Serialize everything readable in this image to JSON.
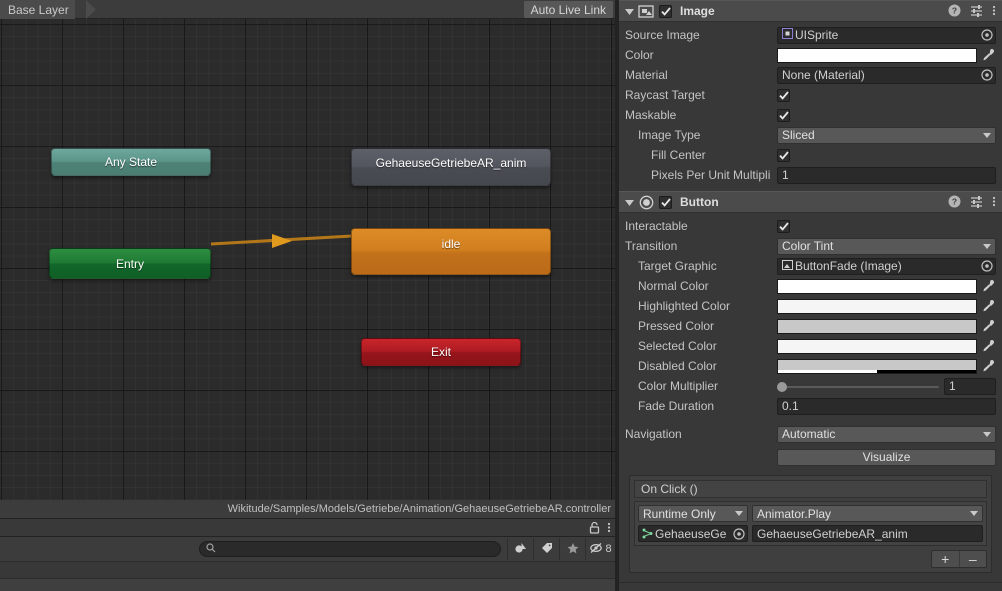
{
  "animator": {
    "breadcrumb": "Base Layer",
    "auto_live_link": "Auto Live Link",
    "asset_path": "Wikitude/Samples/Models/Getriebe/Animation/GehaeuseGetriebeAR.controller",
    "nodes": [
      {
        "name": "Any State",
        "type": "any-state",
        "color": "#5b9488"
      },
      {
        "name": "Entry",
        "type": "entry",
        "color": "#1e7a33"
      },
      {
        "name": "idle",
        "type": "state-default",
        "color": "#d2801f"
      },
      {
        "name": "Exit",
        "type": "exit",
        "color": "#ad1b22"
      },
      {
        "name": "GehaeuseGetriebeAR_anim",
        "type": "state",
        "color": "#53565e"
      }
    ],
    "transition": {
      "from": "Entry",
      "to": "idle",
      "color": "#b3771a"
    }
  },
  "project_browser": {
    "search_placeholder": "",
    "search_value": "",
    "hidden_count": "8",
    "icons": {
      "lock": "lock-icon",
      "menu": "kebab-menu-icon",
      "search": "search-icon",
      "filter_type": "filter-by-type-icon",
      "filter_label": "filter-by-label-icon",
      "favorites": "favorites-star-icon",
      "hidden_packages": "hidden-packages-icon"
    }
  },
  "inspector": {
    "components": [
      {
        "title": "Image",
        "icon": "image-component-icon",
        "enabled": true,
        "expanded": true,
        "header_buttons": [
          "help-icon",
          "preset-icon",
          "kebab-menu-icon"
        ],
        "fields": [
          {
            "label": "Source Image",
            "type": "object",
            "value": "UISprite",
            "icon": "sprite-icon",
            "indent": 0
          },
          {
            "label": "Color",
            "type": "color",
            "value": "#ffffff",
            "alpha": 100,
            "indent": 0
          },
          {
            "label": "Material",
            "type": "object",
            "value": "None (Material)",
            "icon": "",
            "indent": 0
          },
          {
            "label": "Raycast Target",
            "type": "checkbox",
            "value": true,
            "indent": 0
          },
          {
            "label": "Maskable",
            "type": "checkbox",
            "value": true,
            "indent": 0
          },
          {
            "label": "Image Type",
            "type": "dropdown",
            "value": "Sliced",
            "indent": 1
          },
          {
            "label": "Fill Center",
            "type": "checkbox",
            "value": true,
            "indent": 2
          },
          {
            "label": "Pixels Per Unit Multipli",
            "type": "text",
            "value": "1",
            "indent": 2
          }
        ]
      },
      {
        "title": "Button",
        "icon": "button-component-icon",
        "enabled": true,
        "expanded": true,
        "header_buttons": [
          "help-icon",
          "preset-icon",
          "kebab-menu-icon"
        ],
        "fields": [
          {
            "label": "Interactable",
            "type": "checkbox",
            "value": true,
            "indent": 0
          },
          {
            "label": "Transition",
            "type": "dropdown",
            "value": "Color Tint",
            "indent": 0
          },
          {
            "label": "Target Graphic",
            "type": "object",
            "value": "ButtonFade (Image)",
            "icon": "image-icon",
            "indent": 1
          },
          {
            "label": "Normal Color",
            "type": "color",
            "value": "#ffffff",
            "alpha": 100,
            "indent": 1
          },
          {
            "label": "Highlighted Color",
            "type": "color",
            "value": "#f5f5f5",
            "alpha": 100,
            "indent": 1
          },
          {
            "label": "Pressed Color",
            "type": "color",
            "value": "#c8c8c8",
            "alpha": 100,
            "indent": 1
          },
          {
            "label": "Selected Color",
            "type": "color",
            "value": "#f5f5f5",
            "alpha": 100,
            "indent": 1
          },
          {
            "label": "Disabled Color",
            "type": "color",
            "value": "#c8c8c8",
            "alpha": 50,
            "indent": 1
          },
          {
            "label": "Color Multiplier",
            "type": "slider",
            "value": "1",
            "slider_pct": 0,
            "indent": 1
          },
          {
            "label": "Fade Duration",
            "type": "text",
            "value": "0.1",
            "indent": 1
          },
          {
            "label": "Navigation",
            "type": "dropdown",
            "value": "Automatic",
            "indent": 0
          },
          {
            "label": "",
            "type": "button",
            "value": "Visualize",
            "indent": 0
          }
        ],
        "on_click": {
          "header": "On Click ()",
          "entries": [
            {
              "lifecycle": "Runtime Only",
              "method": "Animator.Play",
              "object": "GehaeuseGe",
              "object_icon": "animator-icon",
              "argument": "GehaeuseGetriebeAR_anim"
            }
          ],
          "add_label": "+",
          "remove_label": "–"
        }
      }
    ]
  },
  "colors": {
    "panel_bg": "#383838",
    "header_bg": "#4b4b4b",
    "field_bg": "#2a2a2a",
    "dropdown_bg": "#585858",
    "graph_bg": "#2b2b2b",
    "text": "#c4c4c4"
  }
}
